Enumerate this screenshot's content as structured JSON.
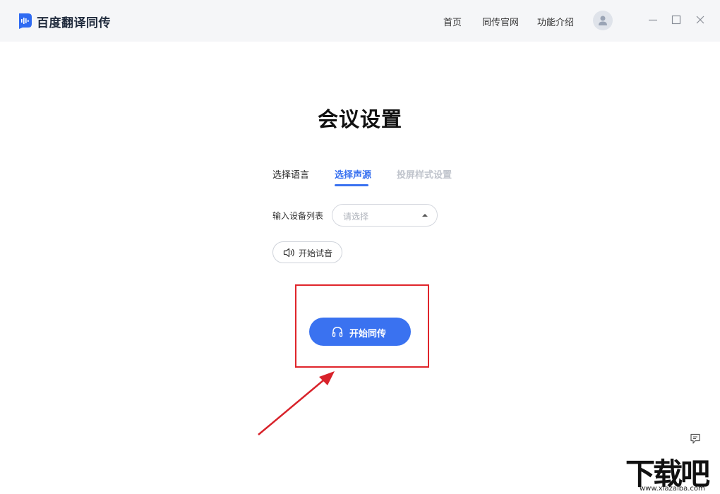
{
  "header": {
    "app_title": "百度翻译同传",
    "nav": [
      {
        "label": "首页"
      },
      {
        "label": "同传官网"
      },
      {
        "label": "功能介绍"
      }
    ],
    "icons": {
      "logo": "baidu-translate-logo",
      "avatar": "user-icon",
      "minimize": "minimize-icon",
      "maximize": "maximize-icon",
      "close": "close-icon"
    }
  },
  "main": {
    "title": "会议设置",
    "tabs": [
      {
        "label": "选择语言",
        "state": "normal"
      },
      {
        "label": "选择声源",
        "state": "active"
      },
      {
        "label": "投屏样式设置",
        "state": "disabled"
      }
    ],
    "input_device": {
      "label": "输入设备列表",
      "placeholder": "请选择"
    },
    "test_button": {
      "label": "开始试音",
      "icon": "speaker-icon"
    },
    "start_button": {
      "label": "开始同传",
      "icon": "headphones-icon"
    }
  },
  "feedback": {
    "icon": "feedback-icon"
  },
  "watermark": {
    "text": "下载吧",
    "url": "www.xiazaiba.com"
  },
  "colors": {
    "accent": "#3a72f0",
    "highlight": "#e0252b",
    "header_bg": "#f5f6f8"
  }
}
